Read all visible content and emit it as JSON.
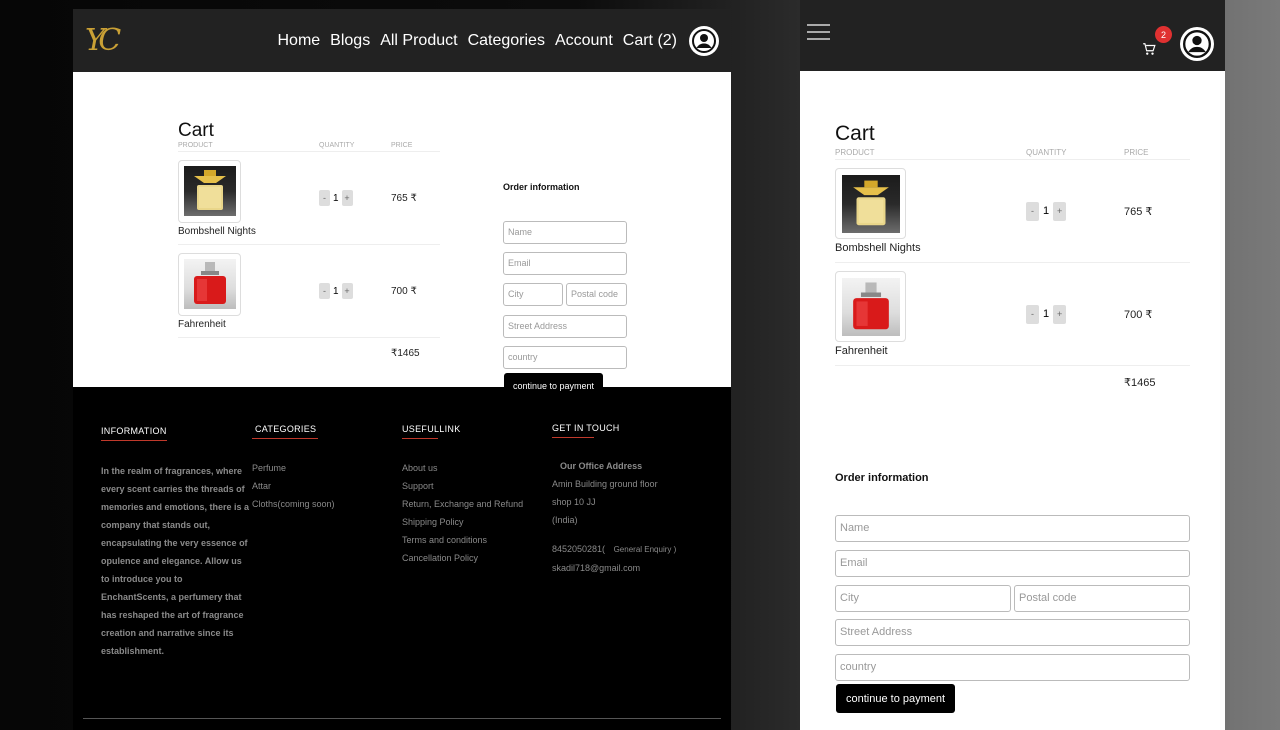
{
  "brand": {
    "logo_text": "YC",
    "colors": {
      "gold": "#c9a035",
      "nav_bg": "#222222",
      "accent_red": "#c0392b"
    }
  },
  "nav": {
    "links": [
      "Home",
      "Blogs",
      "All Product",
      "Categories",
      "Account",
      "Cart (2)"
    ],
    "avatar_icon": "user-circle-icon",
    "menu_icon": "hamburger-icon",
    "cart_icon": "cart-icon",
    "cart_count": "2"
  },
  "cart": {
    "title": "Cart",
    "headers": [
      "PRODUCT",
      "QUANTITY",
      "PRICE"
    ],
    "items": [
      {
        "name": "Bombshell Nights",
        "qty": "1",
        "price": "765 ₹",
        "minus": "-",
        "plus": "+"
      },
      {
        "name": "Fahrenheit",
        "qty": "1",
        "price": "700 ₹",
        "minus": "-",
        "plus": "+"
      }
    ],
    "total": "₹1465"
  },
  "order": {
    "title": "Order information",
    "placeholders": {
      "name": "Name",
      "email": "Email",
      "city": "City",
      "postal": "Postal code",
      "street": "Street Address",
      "country": "country"
    },
    "submit": "continue to payment"
  },
  "footer": {
    "information": {
      "heading": "INFORMATION",
      "text": "In the realm of fragrances, where every scent carries the threads of memories and emotions, there is a company that stands out, encapsulating the very essence of opulence and elegance. Allow us to introduce you to EnchantScents, a perfumery that has reshaped the art of fragrance creation and narrative since its establishment."
    },
    "categories": {
      "heading": "CATEGORIES",
      "links": [
        "Perfume",
        "Attar",
        "Cloths(coming soon)"
      ]
    },
    "useful": {
      "heading": "USEFULLINK",
      "links": [
        "About us",
        "Support",
        "Return, Exchange and Refund",
        "Shipping Policy",
        "Terms and conditions",
        "Cancellation Policy"
      ]
    },
    "contact": {
      "heading": "GET IN TOUCH",
      "office_label": "Our Office Address",
      "address": [
        "Amin Building ground floor",
        "shop 10 JJ",
        "(India)"
      ],
      "phone": "8452050281(",
      "enquiry": "General Enquiry )",
      "email": "skadil718@gmail.com"
    }
  }
}
